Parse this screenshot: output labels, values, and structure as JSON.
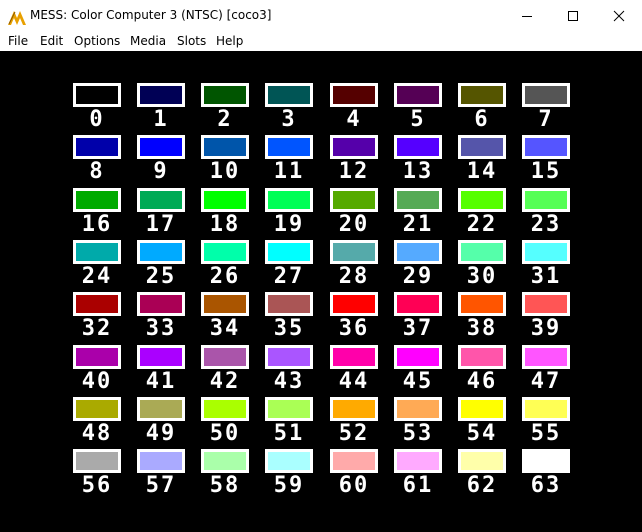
{
  "window": {
    "title": "MESS: Color Computer 3 (NTSC) [coco3]",
    "controls": {
      "minimize": "minimize-icon",
      "maximize": "maximize-icon",
      "close": "close-icon"
    }
  },
  "menu": [
    "File",
    "Edit",
    "Options",
    "Media",
    "Slots",
    "Help"
  ],
  "palette": {
    "cell_border_color": "#ffffff",
    "background": "#000000",
    "colors": [
      {
        "label": "0",
        "color": "#000000"
      },
      {
        "label": "1",
        "color": "#000055"
      },
      {
        "label": "2",
        "color": "#005500"
      },
      {
        "label": "3",
        "color": "#005555"
      },
      {
        "label": "4",
        "color": "#550000"
      },
      {
        "label": "5",
        "color": "#550055"
      },
      {
        "label": "6",
        "color": "#555500"
      },
      {
        "label": "7",
        "color": "#555555"
      },
      {
        "label": "8",
        "color": "#0000aa"
      },
      {
        "label": "9",
        "color": "#0000ff"
      },
      {
        "label": "10",
        "color": "#0055aa"
      },
      {
        "label": "11",
        "color": "#0055ff"
      },
      {
        "label": "12",
        "color": "#5500aa"
      },
      {
        "label": "13",
        "color": "#5500ff"
      },
      {
        "label": "14",
        "color": "#5555aa"
      },
      {
        "label": "15",
        "color": "#5555ff"
      },
      {
        "label": "16",
        "color": "#00aa00"
      },
      {
        "label": "17",
        "color": "#00aa55"
      },
      {
        "label": "18",
        "color": "#00ff00"
      },
      {
        "label": "19",
        "color": "#00ff55"
      },
      {
        "label": "20",
        "color": "#55aa00"
      },
      {
        "label": "21",
        "color": "#55aa55"
      },
      {
        "label": "22",
        "color": "#55ff00"
      },
      {
        "label": "23",
        "color": "#55ff55"
      },
      {
        "label": "24",
        "color": "#00aaaa"
      },
      {
        "label": "25",
        "color": "#00aaff"
      },
      {
        "label": "26",
        "color": "#00ffaa"
      },
      {
        "label": "27",
        "color": "#00ffff"
      },
      {
        "label": "28",
        "color": "#55aaaa"
      },
      {
        "label": "29",
        "color": "#55aaff"
      },
      {
        "label": "30",
        "color": "#55ffaa"
      },
      {
        "label": "31",
        "color": "#55ffff"
      },
      {
        "label": "32",
        "color": "#aa0000"
      },
      {
        "label": "33",
        "color": "#aa0055"
      },
      {
        "label": "34",
        "color": "#aa5500"
      },
      {
        "label": "35",
        "color": "#aa5555"
      },
      {
        "label": "36",
        "color": "#ff0000"
      },
      {
        "label": "37",
        "color": "#ff0055"
      },
      {
        "label": "38",
        "color": "#ff5500"
      },
      {
        "label": "39",
        "color": "#ff5555"
      },
      {
        "label": "40",
        "color": "#aa00aa"
      },
      {
        "label": "41",
        "color": "#aa00ff"
      },
      {
        "label": "42",
        "color": "#aa55aa"
      },
      {
        "label": "43",
        "color": "#aa55ff"
      },
      {
        "label": "44",
        "color": "#ff00aa"
      },
      {
        "label": "45",
        "color": "#ff00ff"
      },
      {
        "label": "46",
        "color": "#ff55aa"
      },
      {
        "label": "47",
        "color": "#ff55ff"
      },
      {
        "label": "48",
        "color": "#aaaa00"
      },
      {
        "label": "49",
        "color": "#aaaa55"
      },
      {
        "label": "50",
        "color": "#aaff00"
      },
      {
        "label": "51",
        "color": "#aaff55"
      },
      {
        "label": "52",
        "color": "#ffaa00"
      },
      {
        "label": "53",
        "color": "#ffaa55"
      },
      {
        "label": "54",
        "color": "#ffff00"
      },
      {
        "label": "55",
        "color": "#ffff55"
      },
      {
        "label": "56",
        "color": "#aaaaaa"
      },
      {
        "label": "57",
        "color": "#aaaaff"
      },
      {
        "label": "58",
        "color": "#aaffaa"
      },
      {
        "label": "59",
        "color": "#aaffff"
      },
      {
        "label": "60",
        "color": "#ffaaaa"
      },
      {
        "label": "61",
        "color": "#ffaaff"
      },
      {
        "label": "62",
        "color": "#ffffaa"
      },
      {
        "label": "63",
        "color": "#ffffff"
      }
    ]
  }
}
